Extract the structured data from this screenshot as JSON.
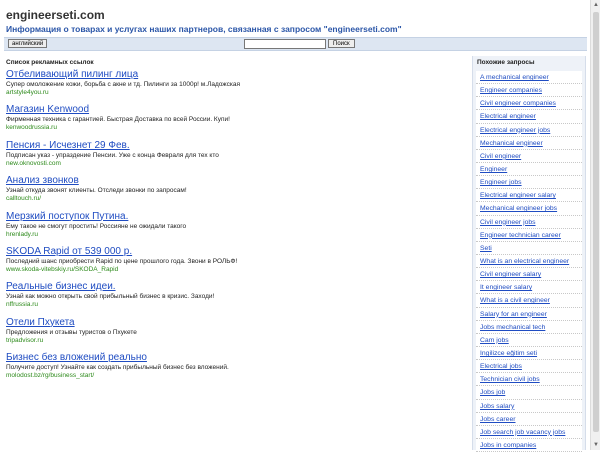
{
  "site": {
    "title": "engineerseti.com",
    "subtitle": "Информация о товарах и услугах наших партнеров, связанная с запросом \"engineerseti.com\""
  },
  "toolbar": {
    "lang_label": "английский",
    "search_value": "",
    "search_button": "Поиск"
  },
  "ads": {
    "title": "Список рекламных ссылок",
    "items": [
      {
        "title": "Отбеливающий пилинг лица",
        "desc": "Супер омоложение кожи, борьба с акне и тд. Пилинги за 1000р! м.Ладожская",
        "url": "artstyle4you.ru"
      },
      {
        "title": "Магазин Kenwood",
        "desc": "Фирменная техника с гарантией. Быстрая Доставка по всей России. Купи!",
        "url": "kenwoodrussia.ru"
      },
      {
        "title": "Пенсия - Исчезнет 29 Фев.",
        "desc": "Подписан указ - упраздение Пенсии. Уже с конца Февраля для тех кто",
        "url": "new.oknovosti.com"
      },
      {
        "title": "Анализ звонков",
        "desc": "Узнай откуда звонят клиенты. Отследи звонки по запросам!",
        "url": "calltouch.ru/"
      },
      {
        "title": "Мерзкий поступок Путина.",
        "desc": "Ему такое не смогут простить! Россияне не ожидали такого",
        "url": "hrenlady.ru"
      },
      {
        "title": "SKODA Rapid от 539 000 р.",
        "desc": "Последний шанс приобрести Rapid по цене прошлого года. Звони в РОЛЬФ!",
        "url": "www.skoda-vitebskiy.ru/SKODA_Rapid"
      },
      {
        "title": "Реальные бизнес идеи.",
        "desc": "Узнай как можно открыть свой прибыльный бизнес в кризис. Заходи!",
        "url": "nffrussia.ru"
      },
      {
        "title": "Отели Пхукета",
        "desc": "Предложения и отзывы туристов о Пхукете",
        "url": "tripadvisor.ru"
      },
      {
        "title": "Бизнес без вложений реально",
        "desc": "Получите доступ! Узнайте как создать прибыльный бизнес без вложений.",
        "url": "molodost.bz/rg/business_start/"
      }
    ]
  },
  "related": {
    "title": "Похожие запросы",
    "items": [
      "A mechanical engineer",
      "Engineer companies",
      "Civil engineer companies",
      "Electrical engineer",
      "Electrical engineer jobs",
      "Mechanical engineer",
      "Civil engineer",
      "Engineer",
      "Engineer jobs",
      "Electrical engineer salary",
      "Mechanical engineer jobs",
      "Civil engineer jobs",
      "Engineer technician career",
      "Seti",
      "What is an electrical engineer",
      "Civil engineer salary",
      "It engineer salary",
      "What is a civil engineer",
      "Salary for an engineer",
      "Jobs mechanical tech",
      "Cam jobs",
      "Ingilizce eğitim seti",
      "Electrical jobs",
      "Technician civil jobs",
      "Jobs job",
      "Jobs salary",
      "Jobs career",
      "Job search job vacancy jobs",
      "Jobs in companies"
    ]
  },
  "colors": {
    "link": "#1f4cc2",
    "url_green": "#2d8a1b",
    "subtitle_blue": "#2b56a8",
    "toolbar_bg": "#dde6f2",
    "sidebar_bg": "#eef2f8"
  }
}
